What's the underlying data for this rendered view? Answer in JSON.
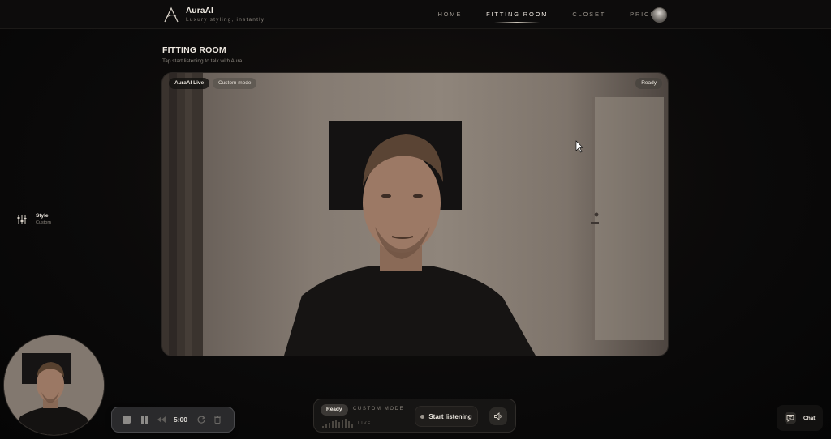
{
  "header": {
    "brand_name": "AuraAI",
    "brand_tagline": "Luxury styling, instantly",
    "nav": [
      {
        "label": "HOME",
        "active": false
      },
      {
        "label": "FITTING ROOM",
        "active": true
      },
      {
        "label": "CLOSET",
        "active": false
      },
      {
        "label": "PRICING",
        "active": false
      }
    ]
  },
  "page": {
    "title": "FITTING ROOM",
    "subtitle": "Tap start listening to talk with Aura."
  },
  "stage": {
    "live_badge": "AuraAI Live",
    "mode_badge": "Custom mode",
    "status_badge": "Ready"
  },
  "style_widget": {
    "label": "Style",
    "value": "Custom"
  },
  "recorder": {
    "time": "5:00"
  },
  "dock": {
    "status": "Ready",
    "mode_label": "CUSTOM MODE",
    "live_label": "LIVE",
    "start_label": "Start listening"
  },
  "chat": {
    "label": "Chat"
  },
  "colors": {
    "background": "#0b0a0a",
    "accent_text": "#efe9e1",
    "muted_text": "#8d877f"
  }
}
